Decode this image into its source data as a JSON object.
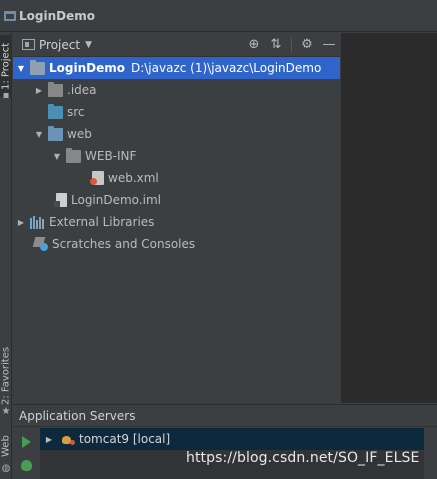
{
  "titlebar": {
    "title": "LoginDemo"
  },
  "left_strip": {
    "project_tab": "1: Project",
    "favorites_tab": "2: Favorites",
    "web_tab": "Web"
  },
  "project_panel": {
    "view_label": "Project",
    "tree": [
      {
        "label": "LoginDemo",
        "path": "D:\\javazc (1)\\javazc\\LoginDemo",
        "icon": "module-folder-icon"
      },
      {
        "label": ".idea",
        "icon": "folder-icon"
      },
      {
        "label": "src",
        "icon": "source-folder-icon"
      },
      {
        "label": "web",
        "icon": "web-folder-icon"
      },
      {
        "label": "WEB-INF",
        "icon": "folder-icon"
      },
      {
        "label": "web.xml",
        "icon": "xml-file-icon"
      },
      {
        "label": "LoginDemo.iml",
        "icon": "iml-file-icon"
      },
      {
        "label": "External Libraries",
        "icon": "libraries-icon"
      },
      {
        "label": "Scratches and Consoles",
        "icon": "scratches-icon"
      }
    ]
  },
  "servers_panel": {
    "title": "Application Servers",
    "servers": [
      {
        "label": "tomcat9 [local]",
        "icon": "tomcat-icon"
      }
    ]
  },
  "watermark": "https://blog.csdn.net/SO_IF_ELSE",
  "colors": {
    "background": "#3c3f41",
    "editor": "#2b2b2b",
    "selection": "#2f65ca",
    "server_selection": "#0d293e",
    "run_green": "#499c54"
  }
}
